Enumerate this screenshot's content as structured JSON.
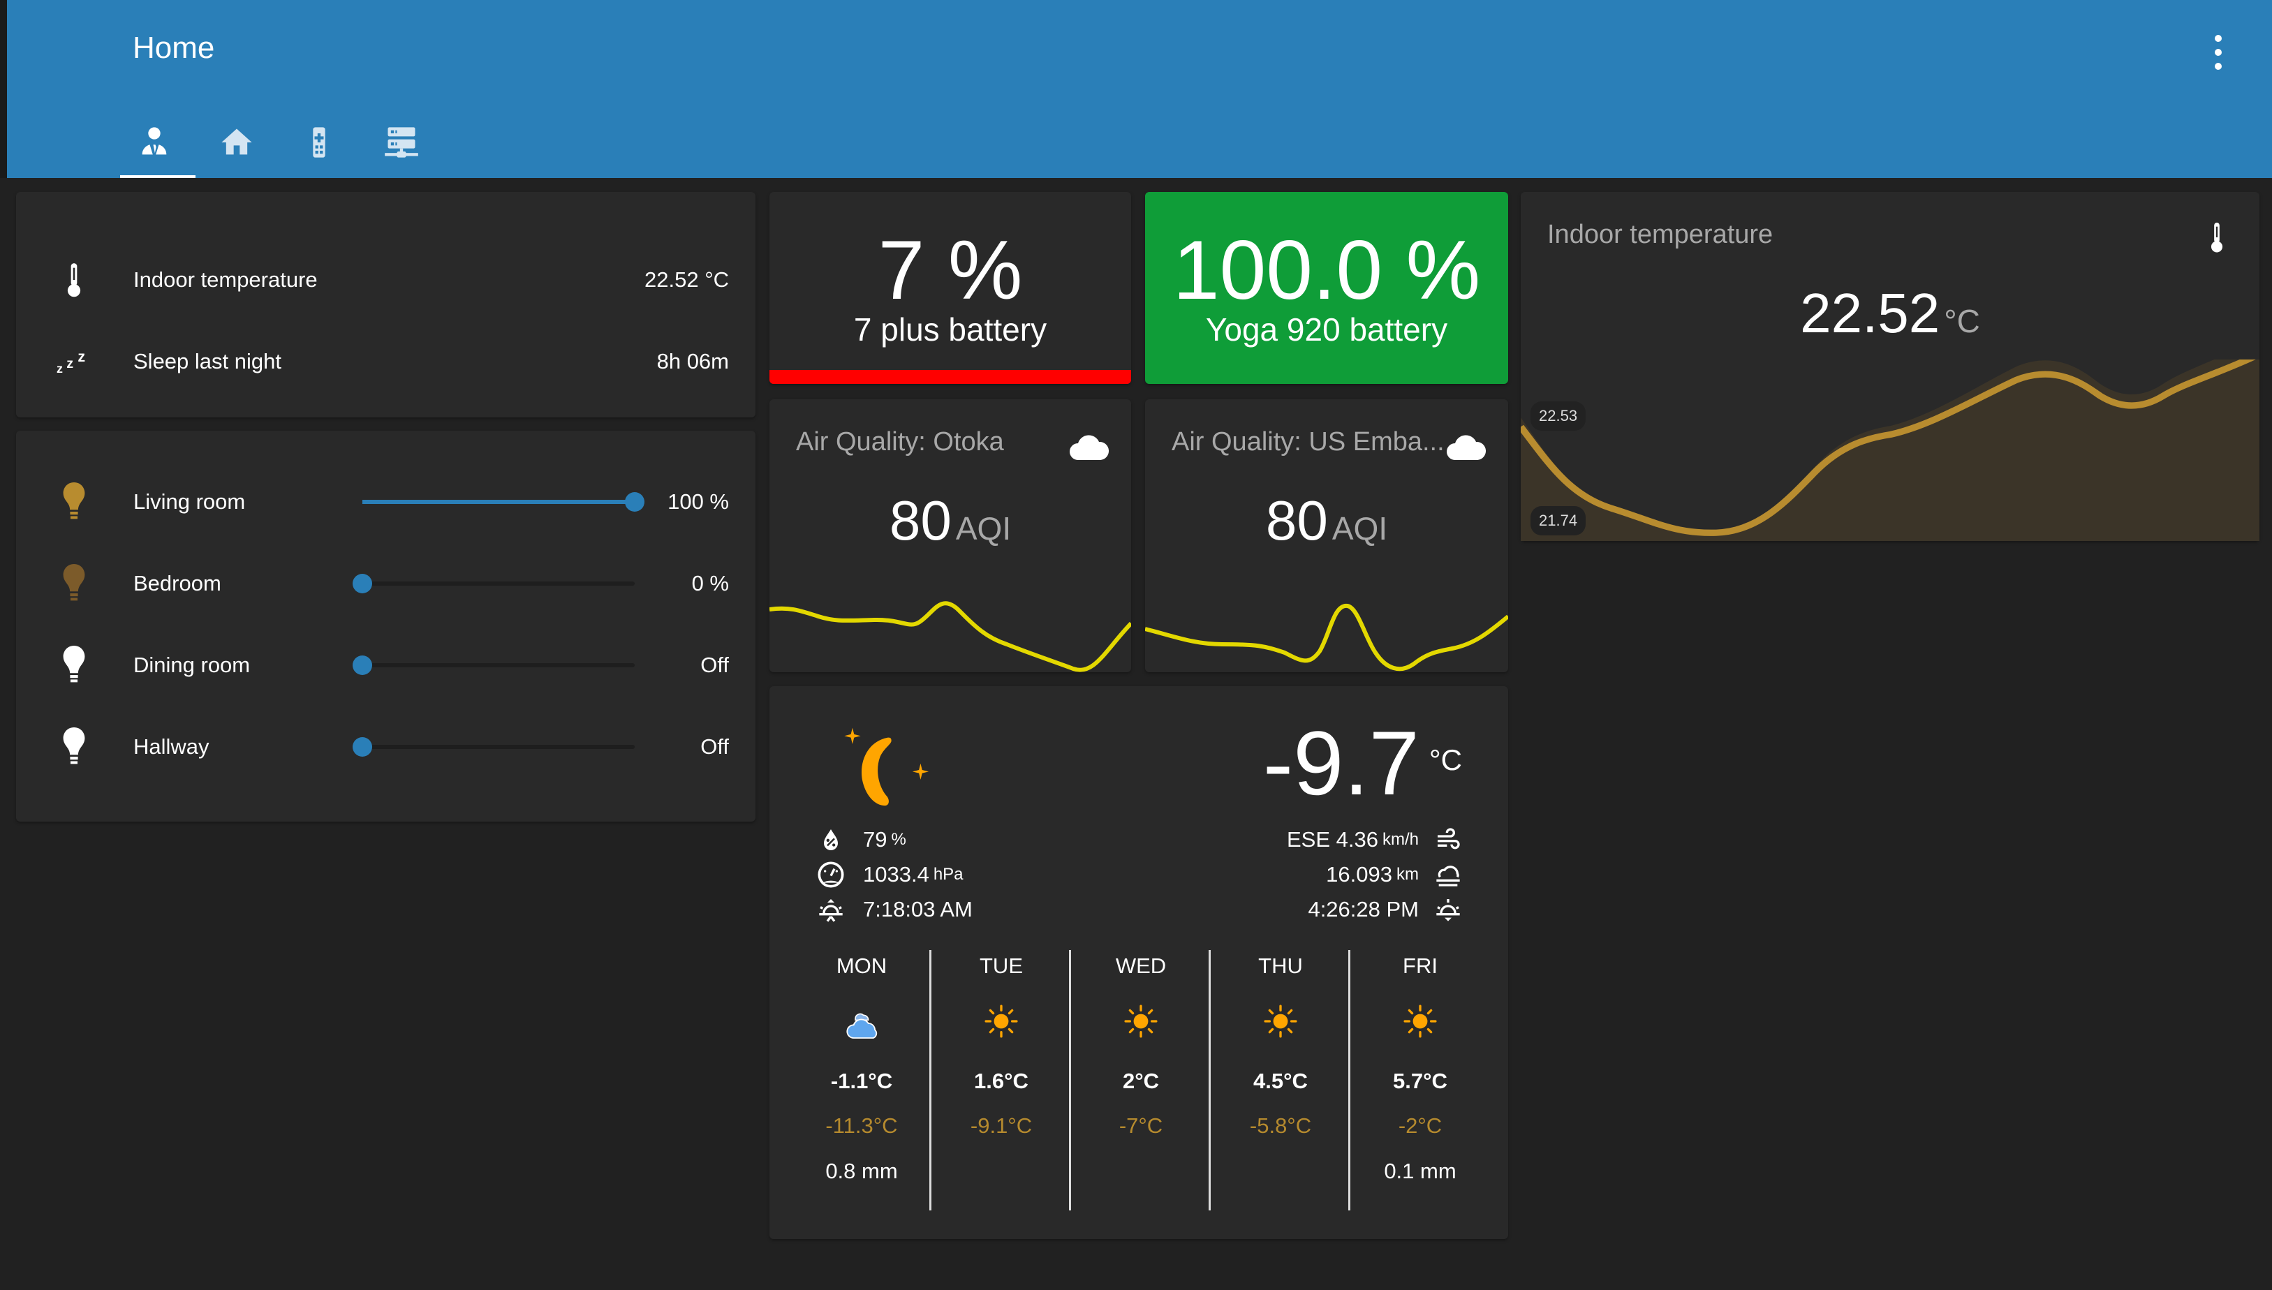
{
  "header": {
    "title": "Home",
    "menu_icon": "dots-vertical-icon",
    "tabs": [
      {
        "icon": "account-tie-icon",
        "active": true
      },
      {
        "icon": "home-icon",
        "active": false
      },
      {
        "icon": "remote-icon",
        "active": false
      },
      {
        "icon": "server-network-icon",
        "active": false
      }
    ]
  },
  "sensors_card": {
    "rows": [
      {
        "icon": "thermometer-icon",
        "label": "Indoor temperature",
        "value": "22.52 °C"
      },
      {
        "icon": "sleep-icon",
        "label": "Sleep last night",
        "value": "8h 06m"
      }
    ]
  },
  "lights_card": {
    "rows": [
      {
        "icon": "lightbulb-icon",
        "label": "Living room",
        "value": "100 %",
        "brightness_pct": 100,
        "icon_color": "#b88c2f"
      },
      {
        "icon": "lightbulb-icon",
        "label": "Bedroom",
        "value": "0 %",
        "brightness_pct": 0,
        "icon_color": "#7c5b2a"
      },
      {
        "icon": "lightbulb-icon",
        "label": "Dining room",
        "value": "Off",
        "brightness_pct": 0,
        "icon_color": "#ffffff"
      },
      {
        "icon": "lightbulb-icon",
        "label": "Hallway",
        "value": "Off",
        "brightness_pct": 0,
        "icon_color": "#ffffff"
      }
    ]
  },
  "batteries": [
    {
      "value": "7 %",
      "name": "7 plus battery",
      "bg_color": "#292929",
      "bar_color": "#ff0000"
    },
    {
      "value": "100.0 %",
      "name": "Yoga 920 battery",
      "bg_color": "#0f9d38"
    }
  ],
  "air_quality": [
    {
      "title": "Air Quality: Otoka",
      "icon": "cloud-icon",
      "value": "80",
      "unit": "AQI",
      "line_color": "#e3d800"
    },
    {
      "title": "Air Quality: US Emba...",
      "icon": "cloud-icon",
      "value": "80",
      "unit": "AQI",
      "line_color": "#e3d800"
    }
  ],
  "indoor_temp_card": {
    "title": "Indoor temperature",
    "icon": "thermometer-icon",
    "value": "22.52",
    "unit": "°C",
    "max_label": "22.53",
    "min_label": "21.74",
    "line_color": "#b88c2f",
    "fill_color": "#3b3428"
  },
  "weather": {
    "condition_icon": "clear-night-icon",
    "temperature": "-9.7",
    "temperature_unit": "°C",
    "humidity": {
      "icon": "water-percent-icon",
      "value": "79",
      "unit": "%"
    },
    "pressure": {
      "icon": "gauge-icon",
      "value": "1033.4",
      "unit": "hPa"
    },
    "sunrise": {
      "icon": "weather-sunset-up-icon",
      "value": "7:18:03 AM"
    },
    "wind": {
      "icon": "weather-windy-icon",
      "value": "ESE 4.36",
      "unit": "km/h"
    },
    "visibility": {
      "icon": "weather-fog-icon",
      "value": "16.093",
      "unit": "km"
    },
    "sunset": {
      "icon": "weather-sunset-down-icon",
      "value": "4:26:28 PM"
    },
    "forecast": [
      {
        "day": "MON",
        "icon": "cloudy-icon",
        "high": "-1.1°C",
        "low": "-11.3°C",
        "precip": "0.8 mm"
      },
      {
        "day": "TUE",
        "icon": "sunny-icon",
        "high": "1.6°C",
        "low": "-9.1°C",
        "precip": ""
      },
      {
        "day": "WED",
        "icon": "sunny-icon",
        "high": "2°C",
        "low": "-7°C",
        "precip": ""
      },
      {
        "day": "THU",
        "icon": "sunny-icon",
        "high": "4.5°C",
        "low": "-5.8°C",
        "precip": ""
      },
      {
        "day": "FRI",
        "icon": "sunny-icon",
        "high": "5.7°C",
        "low": "-2°C",
        "precip": "0.1 mm"
      }
    ]
  }
}
